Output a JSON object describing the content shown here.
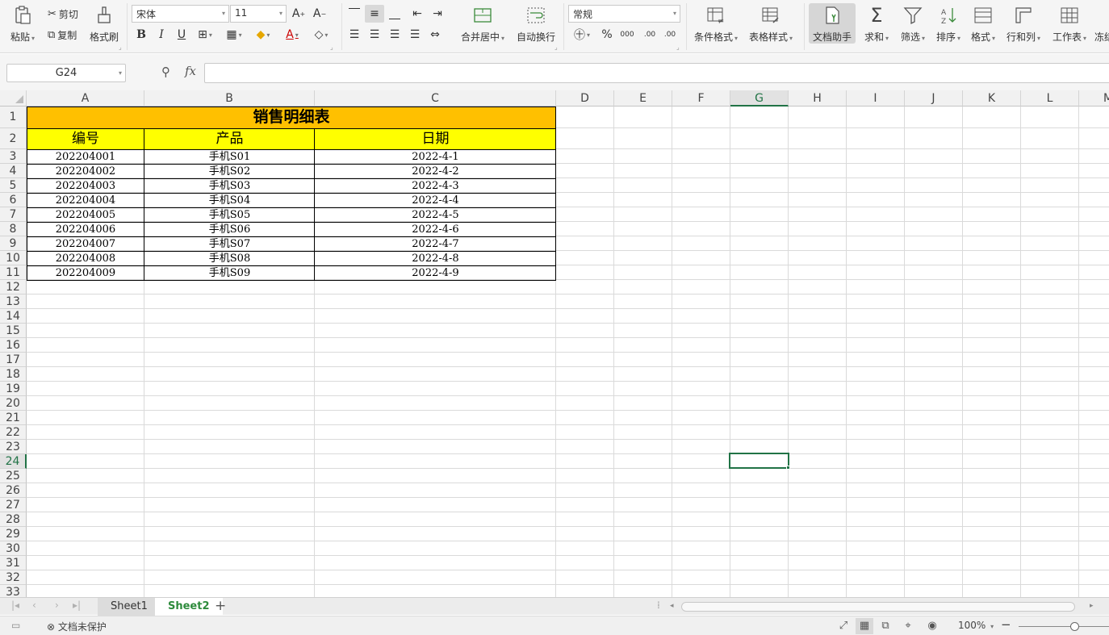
{
  "ribbon": {
    "paste": "粘贴",
    "cut": "剪切",
    "copy": "复制",
    "format_painter": "格式刷",
    "font_name": "宋体",
    "font_size": "11",
    "merge_center": "合并居中",
    "wrap_text": "自动换行",
    "number_format": "常规",
    "conditional_format": "条件格式",
    "table_style": "表格样式",
    "doc_assistant": "文档助手",
    "sum": "求和",
    "filter": "筛选",
    "sort": "排序",
    "format": "格式",
    "rows_cols": "行和列",
    "worksheet": "工作表",
    "freeze": "冻结"
  },
  "formula_bar": {
    "name_box": "G24",
    "fx": "fx",
    "content": ""
  },
  "grid": {
    "columns": [
      "A",
      "B",
      "C",
      "D",
      "E",
      "F",
      "G",
      "H",
      "I",
      "J",
      "K",
      "L",
      "M"
    ],
    "selected_column": "G",
    "rows": [
      "1",
      "2",
      "3",
      "4",
      "5",
      "6",
      "7",
      "8",
      "9",
      "10",
      "11",
      "12",
      "13",
      "14",
      "15",
      "16",
      "17",
      "18",
      "19",
      "20",
      "21",
      "22",
      "23",
      "24",
      "25",
      "26",
      "27",
      "28",
      "29",
      "30",
      "31",
      "32",
      "33"
    ],
    "selected_row": "24"
  },
  "table": {
    "title": "销售明细表",
    "headers": [
      "编号",
      "产品",
      "日期"
    ],
    "rows": [
      [
        "202204001",
        "手机S01",
        "2022-4-1"
      ],
      [
        "202204002",
        "手机S02",
        "2022-4-2"
      ],
      [
        "202204003",
        "手机S03",
        "2022-4-3"
      ],
      [
        "202204004",
        "手机S04",
        "2022-4-4"
      ],
      [
        "202204005",
        "手机S05",
        "2022-4-5"
      ],
      [
        "202204006",
        "手机S06",
        "2022-4-6"
      ],
      [
        "202204007",
        "手机S07",
        "2022-4-7"
      ],
      [
        "202204008",
        "手机S08",
        "2022-4-8"
      ],
      [
        "202204009",
        "手机S09",
        "2022-4-9"
      ]
    ]
  },
  "tabs": {
    "sheet1": "Sheet1",
    "sheet2": "Sheet2",
    "active": "Sheet2"
  },
  "status": {
    "protect": "文档未保护",
    "zoom": "100%"
  },
  "colors": {
    "title_fill": "#FFC000",
    "header_fill": "#FFFF00",
    "selection": "#217346"
  }
}
